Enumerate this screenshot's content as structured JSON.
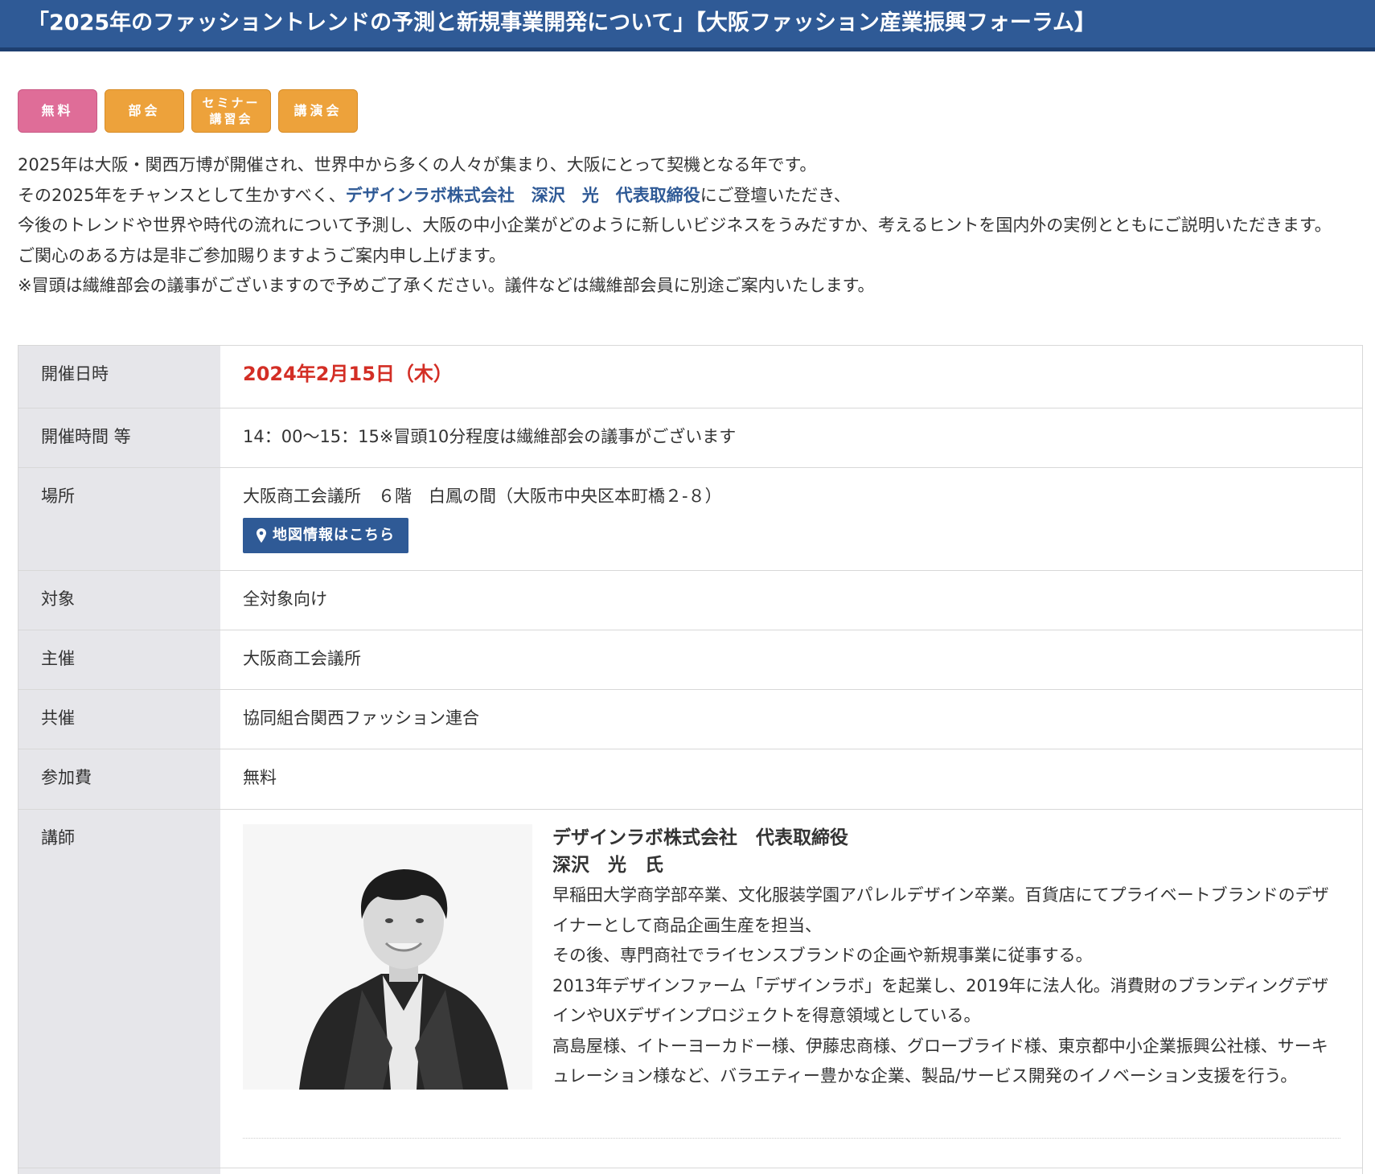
{
  "page_title": "「2025年のファッショントレンドの予測と新規事業開発について」【大阪ファッション産業振興フォーラム】",
  "tags": [
    {
      "label": "無料",
      "color": "#df6d98"
    },
    {
      "label": "部会",
      "color": "#eda23b"
    },
    {
      "label_line1": "セミナー",
      "label_line2": "講習会",
      "color": "#eda23b"
    },
    {
      "label": "講演会",
      "color": "#eda23b"
    }
  ],
  "intro": {
    "line1": "2025年は大阪・関西万博が開催され、世界中から多くの人々が集まり、大阪にとって契機となる年です。",
    "line2_before": "その2025年をチャンスとして生かすべく、",
    "line2_link": "デザインラボ株式会社　深沢　光　代表取締役",
    "line2_after": "にご登壇いただき、",
    "line3": "今後のトレンドや世界や時代の流れについて予測し、大阪の中小企業がどのように新しいビジネスをうみだすか、考えるヒントを国内外の実例とともにご説明いただきます。",
    "line4": "ご関心のある方は是非ご参加賜りますようご案内申し上げます。",
    "line5": "※冒頭は繊維部会の議事がございますので予めご了承ください。議件などは繊維部会員に別途ご案内いたします。"
  },
  "info": {
    "date": {
      "label": "開催日時",
      "value": "2024年2月15日（木）"
    },
    "time": {
      "label": "開催時間 等",
      "value": "14：00〜15：15※冒頭10分程度は繊維部会の議事がございます"
    },
    "place": {
      "label": "場所",
      "value": "大阪商工会議所　６階　白鳳の間（大阪市中央区本町橋２-８）",
      "map_button": "地図情報はこちら",
      "map_icon": "map-pin-icon"
    },
    "target": {
      "label": "対象",
      "value": "全対象向け"
    },
    "organizer": {
      "label": "主催",
      "value": "大阪商工会議所"
    },
    "co_organizer": {
      "label": "共催",
      "value": "協同組合関西ファッション連合"
    },
    "fee": {
      "label": "参加費",
      "value": "無料"
    },
    "lecturer": {
      "label": "講師",
      "company": "デザインラボ株式会社　代表取締役",
      "name": "深沢　光　氏",
      "bio": [
        "早稲田大学商学部卒業、文化服装学園アパレルデザイン卒業。百貨店にてプライベートブランドのデザイナーとして商品企画生産を担当、",
        "その後、専門商社でライセンスブランドの企画や新規事業に従事する。",
        "2013年デザインファーム「デザインラボ」を起業し、2019年に法人化。消費財のブランディングデザインやUXデザインプロジェクトを得意領域としている。",
        "高島屋様、イトーヨーカドー様、伊藤忠商様、グローブライド様、東京都中小企業振興公社様、サーキュレーション様など、バラエティー豊かな企業、製品/サービス開発のイノベーション支援を行う。"
      ]
    }
  }
}
